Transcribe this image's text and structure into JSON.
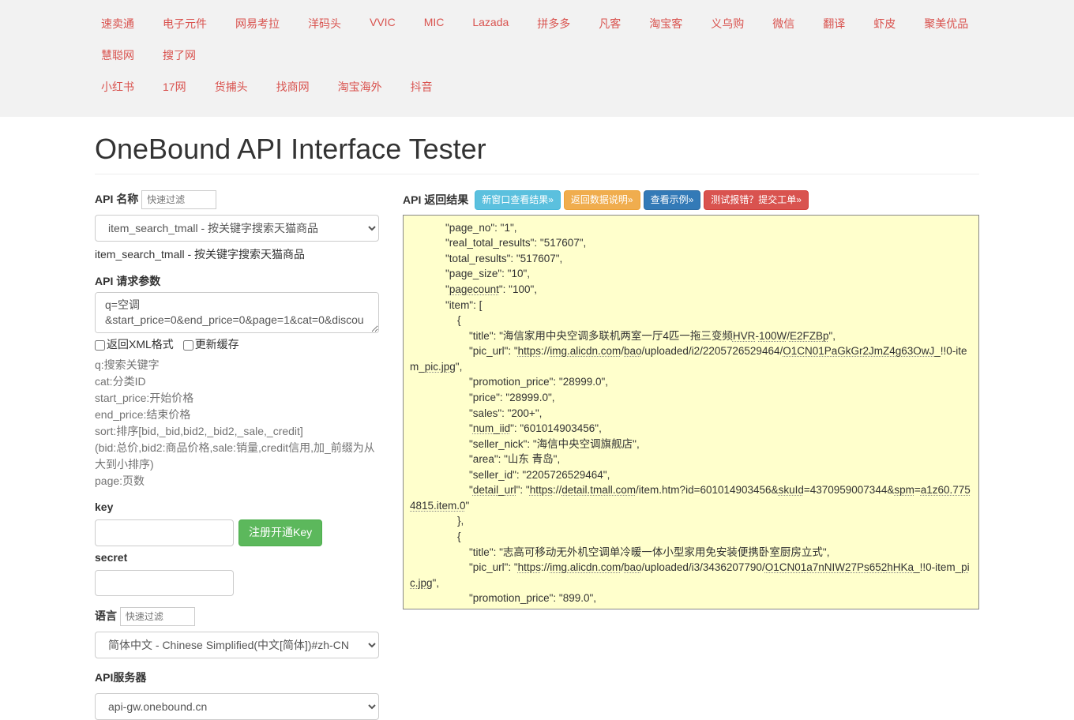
{
  "nav": {
    "row1": [
      "速卖通",
      "电子元件",
      "网易考拉",
      "洋码头",
      "VVIC",
      "MIC",
      "Lazada",
      "拼多多",
      "凡客",
      "淘宝客",
      "义乌购",
      "微信",
      "翻译",
      "虾皮",
      "聚美优品",
      "慧聪网",
      "搜了网"
    ],
    "row2": [
      "小红书",
      "17网",
      "货捕头",
      "找商网",
      "淘宝海外",
      "抖音"
    ]
  },
  "title": "OneBound API Interface Tester",
  "left": {
    "api_name_label": "API 名称",
    "api_name_filter_placeholder": "快速过滤",
    "api_select_value": "item_search_tmall - 按关键字搜索天猫商品",
    "api_desc": "item_search_tmall - 按关键字搜索天猫商品",
    "params_label": "API 请求参数",
    "params_value": "q=空调\n&start_price=0&end_price=0&page=1&cat=0&discoun",
    "chk_xml_label": "返回XML格式",
    "chk_cache_label": "更新缓存",
    "help_text": "q:搜索关键字\ncat:分类ID\nstart_price:开始价格\nend_price:结束价格\nsort:排序[bid,_bid,bid2,_bid2,_sale,_credit]\n  (bid:总价,bid2:商品价格,sale:销量,credit信用,加_前缀为从大到小排序)\npage:页数",
    "key_label": "key",
    "register_key_btn": "注册开通Key",
    "secret_label": "secret",
    "lang_label": "语言",
    "lang_filter_placeholder": "快速过滤",
    "lang_value": "简体中文 - Chinese Simplified(中文[简体])#zh-CN",
    "server_label": "API服务器",
    "server_value": "api-gw.onebound.cn"
  },
  "right": {
    "result_label": "API 返回结果",
    "btn_newwin": "新窗口查看结果»",
    "btn_datadesc": "返回数据说明»",
    "btn_example": "查看示例»",
    "btn_report": "测试报错？提交工单»",
    "result_lines": [
      "            \"page_no\": \"1\",",
      "            \"real_total_results\": \"517607\",",
      "            \"total_results\": \"517607\",",
      "            \"page_size\": \"10\",",
      "            \"pagecount\": \"100\",",
      "            \"item\": [",
      "                {",
      "                    \"title\": \"海信家用中央空调多联机两室一厅4匹一拖三变频HVR-100W/E2FZBp\",",
      "                    \"pic_url\": \"https://img.alicdn.com/bao/uploaded/i2/2205726529464/O1CN01PaGkGr2JmZ4g63OwJ_!!0-item_pic.jpg\",",
      "                    \"promotion_price\": \"28999.0\",",
      "                    \"price\": \"28999.0\",",
      "                    \"sales\": \"200+\",",
      "                    \"num_iid\": \"601014903456\",",
      "                    \"seller_nick\": \"海信中央空调旗舰店\",",
      "                    \"area\": \"山东 青岛\",",
      "                    \"seller_id\": \"2205726529464\",",
      "                    \"detail_url\": \"https://detail.tmall.com/item.htm?id=601014903456&skuId=4370959007344&spm=a1z60.7754815.item.0\"",
      "                },",
      "                {",
      "                    \"title\": \"志高可移动无外机空调单冷暖一体小型家用免安装便携卧室厨房立式\",",
      "                    \"pic_url\": \"https://img.alicdn.com/bao/uploaded/i3/3436207790/O1CN01a7nNIW27Ps652hHKa_!!0-item_pic.jpg\",",
      "                    \"promotion_price\": \"899.0\","
    ]
  }
}
